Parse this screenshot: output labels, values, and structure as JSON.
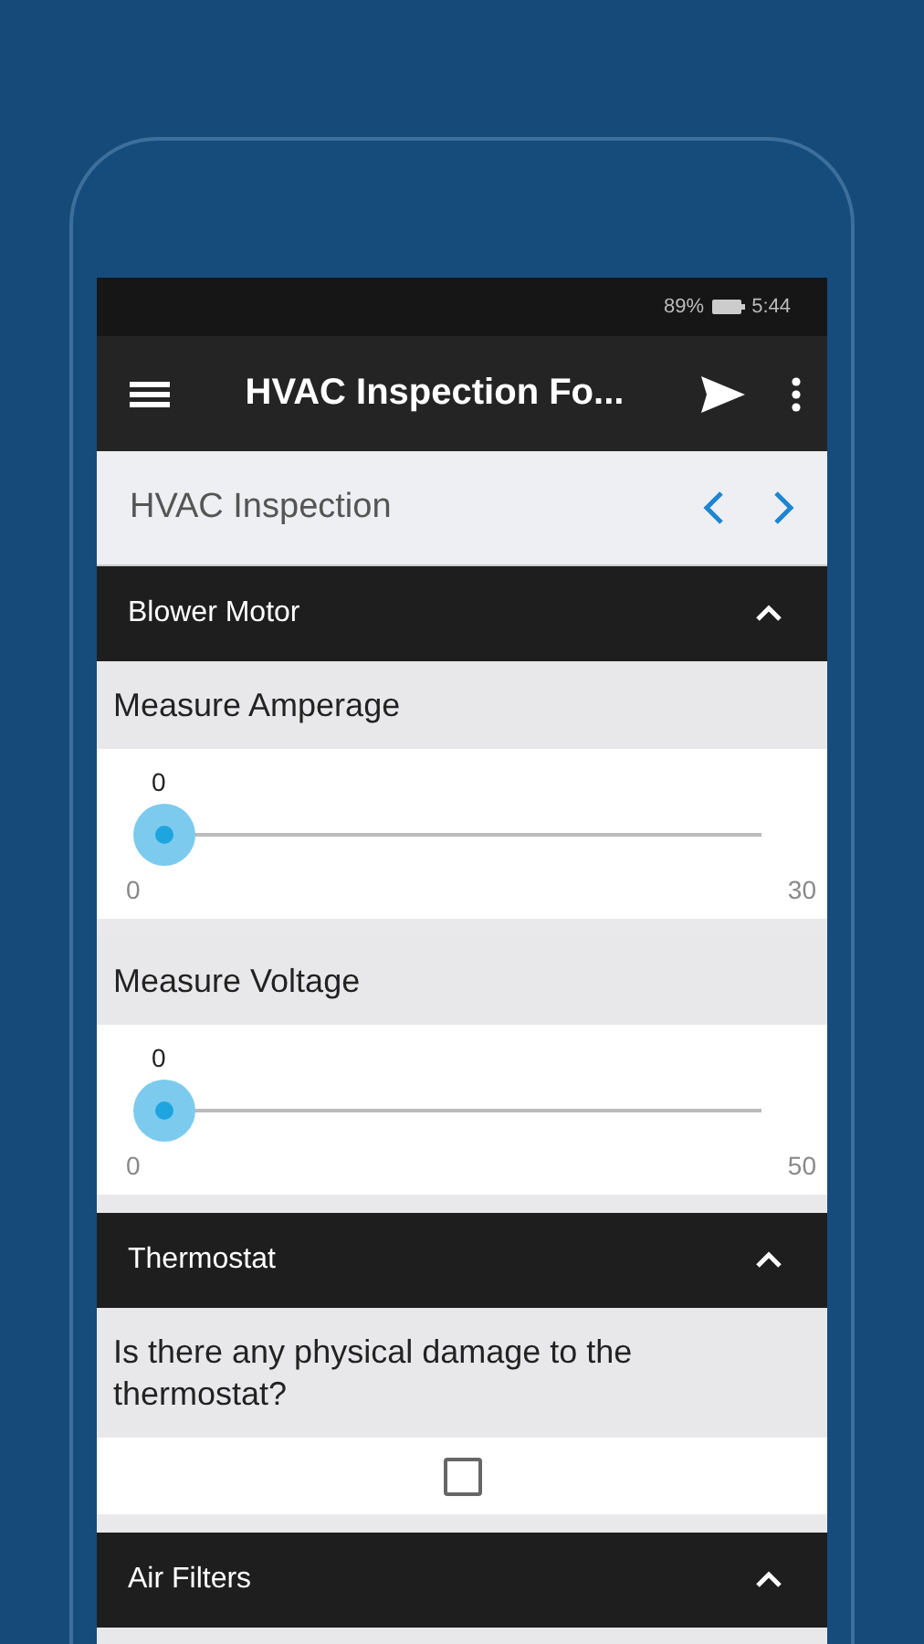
{
  "status_bar": {
    "battery": "89%",
    "time": "5:44"
  },
  "app_bar": {
    "title": "HVAC Inspection Fo..."
  },
  "form_nav": {
    "title": "HVAC Inspection"
  },
  "sections": [
    {
      "title": "Blower Motor",
      "expanded": true,
      "items": [
        {
          "kind": "slider",
          "label": "Measure Amperage",
          "value": "0",
          "level": 0,
          "min": "0",
          "max": "30"
        },
        {
          "kind": "slider",
          "label": "Measure Voltage",
          "value": "0",
          "level": 0,
          "min": "0",
          "max": "50"
        }
      ]
    },
    {
      "title": "Thermostat",
      "expanded": true,
      "items": [
        {
          "kind": "checkbox",
          "label": "Is there any physical damage to the thermostat?",
          "checked": false
        }
      ]
    },
    {
      "title": "Air Filters",
      "expanded": true
    }
  ]
}
